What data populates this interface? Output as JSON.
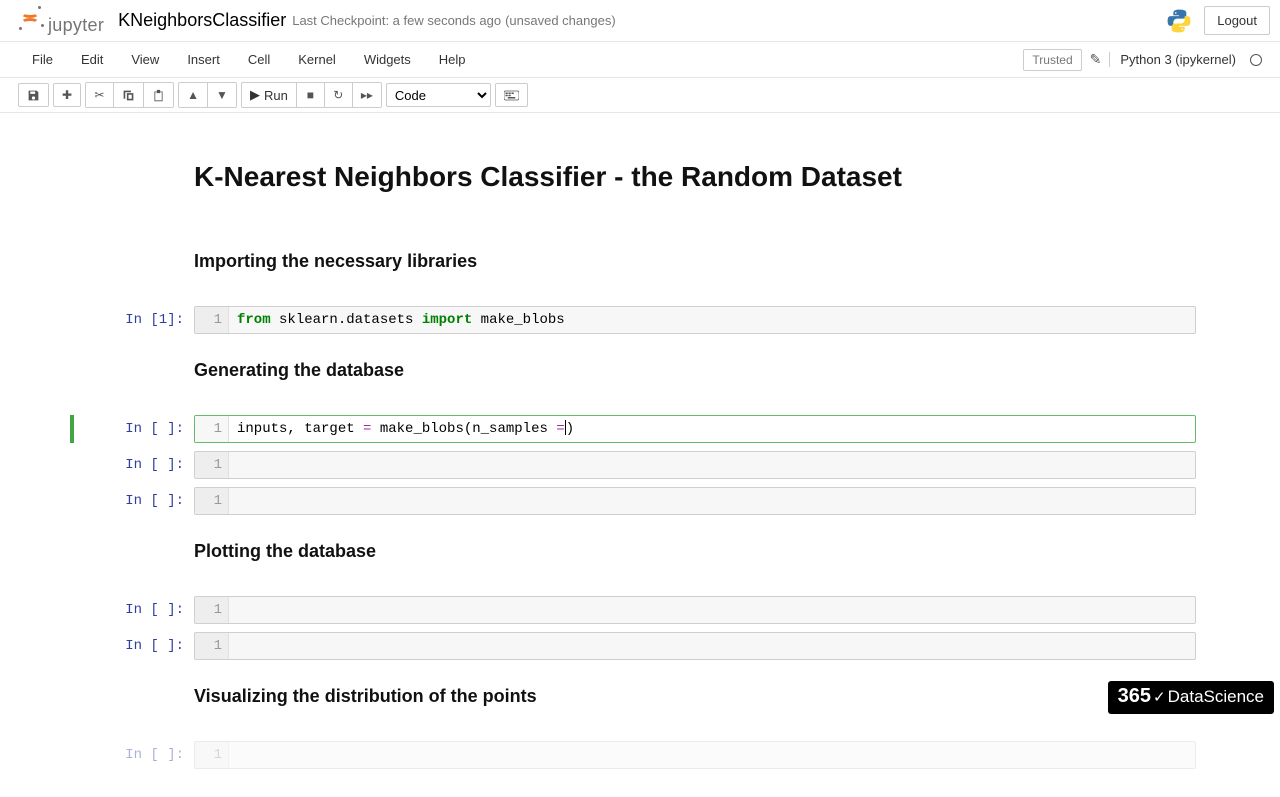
{
  "header": {
    "logo_text": "jupyter",
    "notebook_name": "KNeighborsClassifier",
    "checkpoint": "Last Checkpoint: a few seconds ago",
    "unsaved": "(unsaved changes)",
    "logout": "Logout"
  },
  "menubar": {
    "items": [
      "File",
      "Edit",
      "View",
      "Insert",
      "Cell",
      "Kernel",
      "Widgets",
      "Help"
    ],
    "trusted": "Trusted",
    "kernel": "Python 3 (ipykernel)"
  },
  "toolbar": {
    "run_label": "Run",
    "cell_type": "Code"
  },
  "cells": {
    "h1": "K-Nearest Neighbors Classifier - the Random Dataset",
    "h3_import": "Importing the necessary libraries",
    "h3_generate": "Generating the database",
    "h3_plot": "Plotting the database",
    "h3_viz": "Visualizing the distribution of the points",
    "prompt_in1": "In [1]:",
    "prompt_empty": "In [ ]:",
    "line_no": "1",
    "code1_from": "from",
    "code1_pkg": " sklearn.datasets ",
    "code1_import": "import",
    "code1_name": " make_blobs",
    "code2_pre": "inputs, target ",
    "code2_eq": "=",
    "code2_post": " make_blobs(n_samples ",
    "code2_eq2": "=",
    "code2_close": ")"
  },
  "watermark": {
    "n": "365",
    "ds": "DataScience"
  }
}
